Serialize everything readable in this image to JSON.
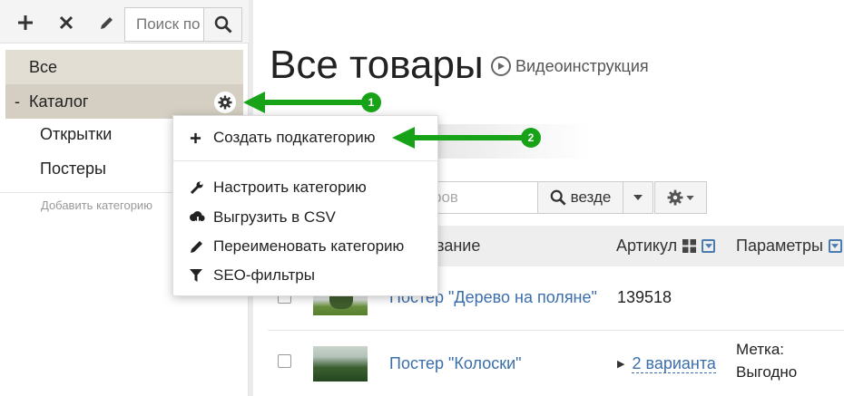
{
  "sidebar": {
    "search": {
      "placeholder": "Поиск по категориям",
      "value": ""
    },
    "items": [
      {
        "label": "Все"
      },
      {
        "label": "Каталог",
        "prefix": "-"
      },
      {
        "label": "Открытки"
      },
      {
        "label": "Постеры"
      }
    ],
    "add_category": "Добавить категорию"
  },
  "main": {
    "title": "Все товары",
    "video_label": "Видеоинструкция",
    "product_search_placeholder": "ров",
    "scope_label": "везде",
    "table": {
      "columns": {
        "name": "вание",
        "sku": "Артикул",
        "params": "Параметры"
      },
      "rows": [
        {
          "name": "Постер \"Дерево на поляне\"",
          "sku": "139518"
        },
        {
          "name": "Постер \"Колоски\"",
          "variants": "2 варианта",
          "tag_line1": "Метка:",
          "tag_line2": "Выгодно"
        }
      ]
    }
  },
  "dropdown": {
    "items": [
      {
        "label": "Создать подкатегорию",
        "icon": "plus-icon"
      },
      {
        "label": "Настроить категорию",
        "icon": "wrench-icon"
      },
      {
        "label": "Выгрузить в CSV",
        "icon": "cloud-download-icon"
      },
      {
        "label": "Переименовать категорию",
        "icon": "pencil-icon"
      },
      {
        "label": "SEO-фильтры",
        "icon": "filter-icon"
      }
    ]
  },
  "annotations": [
    {
      "number": "1"
    },
    {
      "number": "2"
    }
  ],
  "colors": {
    "accent_green": "#18a218",
    "link_blue": "#3b6eaa",
    "tree_selected": "#d4cfc2",
    "tree_all": "#e2ded3"
  }
}
